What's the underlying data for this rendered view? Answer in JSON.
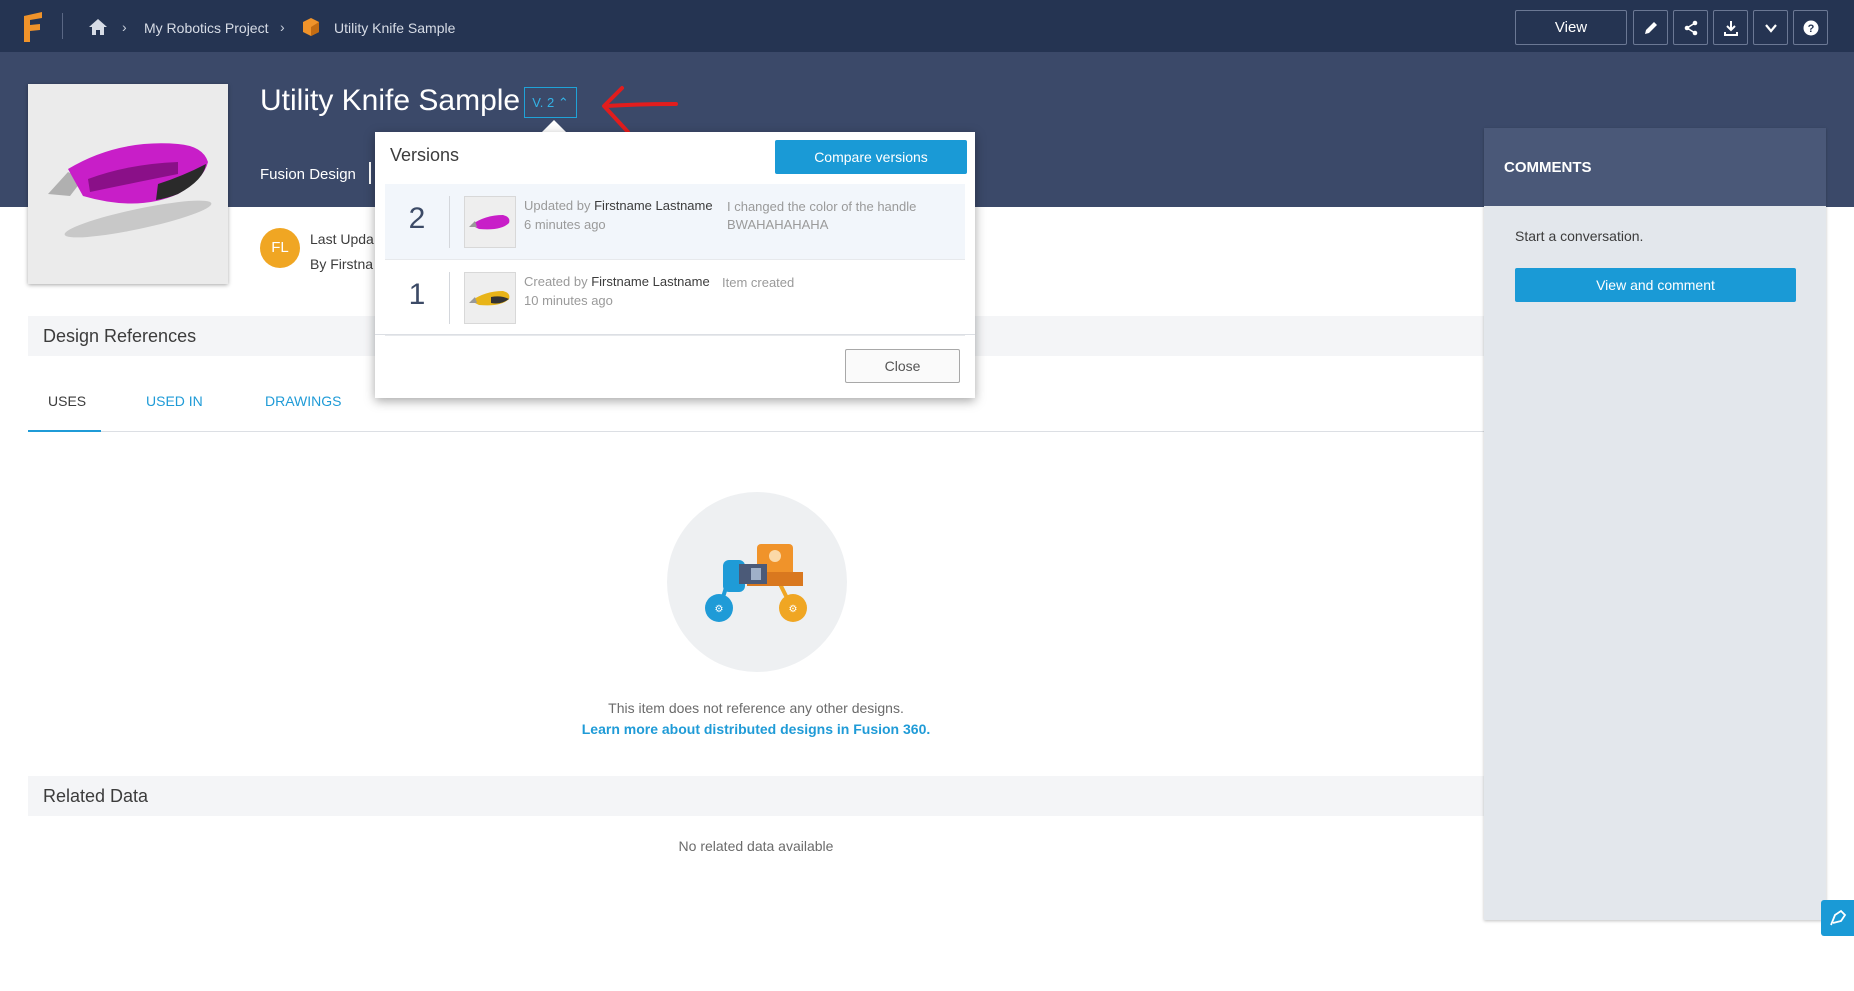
{
  "breadcrumb": {
    "project": "My Robotics Project",
    "item": "Utility Knife Sample"
  },
  "toolbar": {
    "view_label": "View",
    "icons": [
      "pencil-icon",
      "share-icon",
      "download-icon",
      "chevron-down-icon",
      "help-icon"
    ]
  },
  "item": {
    "title": "Utility Knife Sample",
    "version_badge": "V. 2",
    "type": "Fusion Design"
  },
  "last_updated": {
    "avatar_initials": "FL",
    "label": "Last Upda",
    "by": "By Firstna"
  },
  "design_references": {
    "title": "Design References",
    "tabs": [
      {
        "label": "USES",
        "active": true
      },
      {
        "label": "USED IN",
        "active": false
      },
      {
        "label": "DRAWINGS",
        "active": false
      }
    ],
    "empty_text": "This item does not reference any other designs.",
    "learn_link": "Learn more about distributed designs in Fusion 360."
  },
  "related_data": {
    "title": "Related Data",
    "empty_text": "No related data available"
  },
  "comments": {
    "title": "COMMENTS",
    "start_text": "Start a conversation.",
    "button_label": "View and comment"
  },
  "versions_popover": {
    "title": "Versions",
    "compare_label": "Compare versions",
    "close_label": "Close",
    "versions": [
      {
        "number": "2",
        "action": "Updated by ",
        "user": "Firstname Lastname",
        "time": "6 minutes ago",
        "note": "I changed the color of the handle BWAHAHAHAHA",
        "selected": true,
        "thumb_color": "#c81ec8"
      },
      {
        "number": "1",
        "action": "Created by ",
        "user": "Firstname Lastname",
        "time": "10 minutes ago",
        "note": "Item created",
        "selected": false,
        "thumb_color": "#e8b418"
      }
    ]
  },
  "colors": {
    "nav_bg": "#253452",
    "header_bg": "#3b4969",
    "accent": "#1a9ad6",
    "avatar": "#f0a623"
  }
}
